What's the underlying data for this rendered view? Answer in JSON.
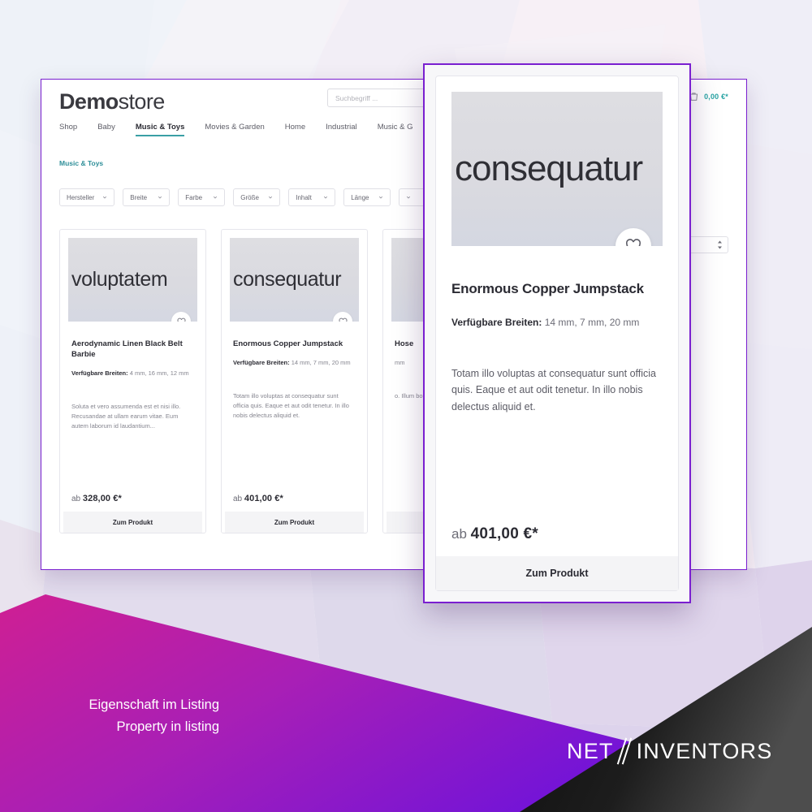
{
  "shop": {
    "brand": {
      "bold": "Demo",
      "light": "store"
    },
    "search": {
      "placeholder": "Suchbegriff ..."
    },
    "cart": {
      "icon": "cart-icon",
      "total": "0,00 €*"
    },
    "nav": [
      {
        "label": "Shop",
        "active": false
      },
      {
        "label": "Baby",
        "active": false
      },
      {
        "label": "Music & Toys",
        "active": true
      },
      {
        "label": "Movies & Garden",
        "active": false
      },
      {
        "label": "Home",
        "active": false
      },
      {
        "label": "Industrial",
        "active": false
      },
      {
        "label": "Music & G",
        "active": false
      }
    ],
    "breadcrumb": "Music & Toys",
    "filters": [
      {
        "label": "Hersteller"
      },
      {
        "label": "Breite"
      },
      {
        "label": "Farbe"
      },
      {
        "label": "Größe"
      },
      {
        "label": "Inhalt"
      },
      {
        "label": "Länge"
      }
    ],
    "products": [
      {
        "thumb_text": "voluptatem",
        "title": "Aerodynamic Linen Black Belt Barbie",
        "property_label": "Verfügbare Breiten:",
        "property_value": "4 mm, 16 mm, 12 mm",
        "description": "Soluta et vero assumenda est et nisi illo. Recusandae at ullam earum vitae. Eum autem laborum id laudantium...",
        "price_prefix": "ab",
        "price": "328,00 €*",
        "button": "Zum Produkt"
      },
      {
        "thumb_text": "consequatur",
        "title": "Enormous Copper Jumpstack",
        "property_label": "Verfügbare Breiten:",
        "property_value": "14 mm, 7 mm, 20 mm",
        "description": "Totam illo voluptas at consequatur sunt officia quis. Eaque et aut odit tenetur. In illo nobis delectus aliquid et.",
        "price_prefix": "ab",
        "price": "401,00 €*",
        "button": "Zum Produkt"
      },
      {
        "thumb_text": "",
        "title": "Hose",
        "property_label": "",
        "property_value": "mm",
        "description": "o. Illum boro",
        "price_prefix": "",
        "price": "",
        "button": ""
      }
    ]
  },
  "modal": {
    "thumb_text": "consequatur",
    "favorite_icon": "heart-icon",
    "title": "Enormous Copper Jumpstack",
    "property_label": "Verfügbare Breiten:",
    "property_value": "14 mm, 7 mm, 20 mm",
    "description": "Totam illo voluptas at consequatur sunt officia quis. Eaque et aut odit tenetur. In illo nobis delectus aliquid et.",
    "price_prefix": "ab",
    "price": "401,00 €*",
    "button": "Zum Produkt"
  },
  "banner": {
    "caption_de": "Eigenschaft im Listing",
    "caption_en": "Property in listing",
    "logo": {
      "left": "NET",
      "right": "INVENTORS"
    }
  },
  "colors": {
    "accent_purple": "#7a1fd0",
    "accent_teal": "#2f8f99",
    "banner_magenta": "#c9219a",
    "banner_violet": "#6a12dd",
    "banner_black": "#121212"
  }
}
